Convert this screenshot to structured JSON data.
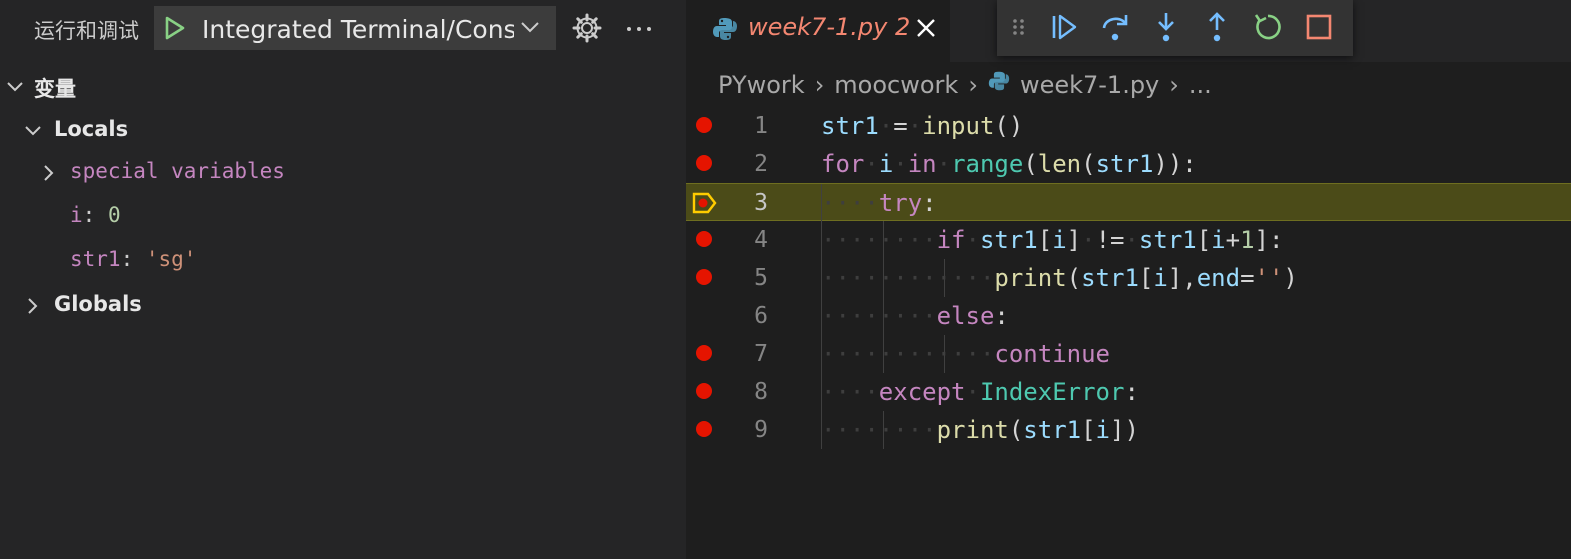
{
  "debug_panel": {
    "title": "运行和调试",
    "config_name": "Integrated Terminal/Console",
    "variables_section": "变量",
    "locals_label": "Locals",
    "special_variables_label": "special variables",
    "vars": [
      {
        "name": "i",
        "value": "0"
      },
      {
        "name": "str1",
        "value": "'sg'"
      }
    ],
    "globals_label": "Globals"
  },
  "editor": {
    "tab": {
      "filename": "week7-1.py",
      "problem_count": "2"
    },
    "breadcrumb": [
      "PYwork",
      "moocwork",
      "week7-1.py",
      "..."
    ],
    "current_line": 3,
    "lines": [
      {
        "no": "1",
        "breakpoint": true
      },
      {
        "no": "2",
        "breakpoint": true
      },
      {
        "no": "3",
        "breakpoint": true
      },
      {
        "no": "4",
        "breakpoint": true
      },
      {
        "no": "5",
        "breakpoint": true
      },
      {
        "no": "6",
        "breakpoint": false
      },
      {
        "no": "7",
        "breakpoint": true
      },
      {
        "no": "8",
        "breakpoint": true
      },
      {
        "no": "9",
        "breakpoint": true
      }
    ],
    "code": [
      [
        [
          "vr",
          "str1"
        ],
        [
          "ws",
          "·"
        ],
        [
          "pun",
          "="
        ],
        [
          "ws",
          "·"
        ],
        [
          "fn",
          "input"
        ],
        [
          "pun",
          "()"
        ]
      ],
      [
        [
          "kw",
          "for"
        ],
        [
          "ws",
          "·"
        ],
        [
          "vr",
          "i"
        ],
        [
          "ws",
          "·"
        ],
        [
          "kw",
          "in"
        ],
        [
          "ws",
          "·"
        ],
        [
          "cls",
          "range"
        ],
        [
          "pun",
          "("
        ],
        [
          "fn",
          "len"
        ],
        [
          "pun",
          "("
        ],
        [
          "vr",
          "str1"
        ],
        [
          "pun",
          "))"
        ],
        [
          "pun",
          ":"
        ]
      ],
      [
        [
          "ws",
          "····"
        ],
        [
          "kw",
          "try"
        ],
        [
          "pun",
          ":"
        ]
      ],
      [
        [
          "ws",
          "········"
        ],
        [
          "kw",
          "if"
        ],
        [
          "ws",
          "·"
        ],
        [
          "vr",
          "str1"
        ],
        [
          "pun",
          "["
        ],
        [
          "vr",
          "i"
        ],
        [
          "pun",
          "]"
        ],
        [
          "ws",
          "·"
        ],
        [
          "pun",
          "!="
        ],
        [
          "ws",
          "·"
        ],
        [
          "vr",
          "str1"
        ],
        [
          "pun",
          "["
        ],
        [
          "vr",
          "i"
        ],
        [
          "pun",
          "+"
        ],
        [
          "num",
          "1"
        ],
        [
          "pun",
          "]:"
        ]
      ],
      [
        [
          "ws",
          "············"
        ],
        [
          "fn",
          "print"
        ],
        [
          "pun",
          "("
        ],
        [
          "vr",
          "str1"
        ],
        [
          "pun",
          "["
        ],
        [
          "vr",
          "i"
        ],
        [
          "pun",
          "],"
        ],
        [
          "vr",
          "end"
        ],
        [
          "pun",
          "="
        ],
        [
          "str",
          "''"
        ],
        [
          "pun",
          ")"
        ]
      ],
      [
        [
          "ws",
          "········"
        ],
        [
          "kw",
          "else"
        ],
        [
          "pun",
          ":"
        ]
      ],
      [
        [
          "ws",
          "············"
        ],
        [
          "kw",
          "continue"
        ]
      ],
      [
        [
          "ws",
          "····"
        ],
        [
          "kw",
          "except"
        ],
        [
          "ws",
          "·"
        ],
        [
          "cls",
          "IndexError"
        ],
        [
          "pun",
          ":"
        ]
      ],
      [
        [
          "ws",
          "········"
        ],
        [
          "fn",
          "print"
        ],
        [
          "pun",
          "("
        ],
        [
          "vr",
          "str1"
        ],
        [
          "pun",
          "["
        ],
        [
          "vr",
          "i"
        ],
        [
          "pun",
          "])"
        ]
      ]
    ]
  },
  "icons": {
    "play": "play-icon",
    "gear": "gear-icon",
    "more": "ellipsis-icon",
    "toolbar": [
      "drag-handle-icon",
      "continue-icon",
      "step-over-icon",
      "step-into-icon",
      "step-out-icon",
      "restart-icon",
      "stop-icon"
    ]
  },
  "colors": {
    "breakpoint": "#e51400",
    "current_line_bg": "#4b4b18",
    "tab_error": "#f48771",
    "play_green": "#89d185",
    "debug_blue": "#75beff",
    "stop_red": "#f48771"
  }
}
